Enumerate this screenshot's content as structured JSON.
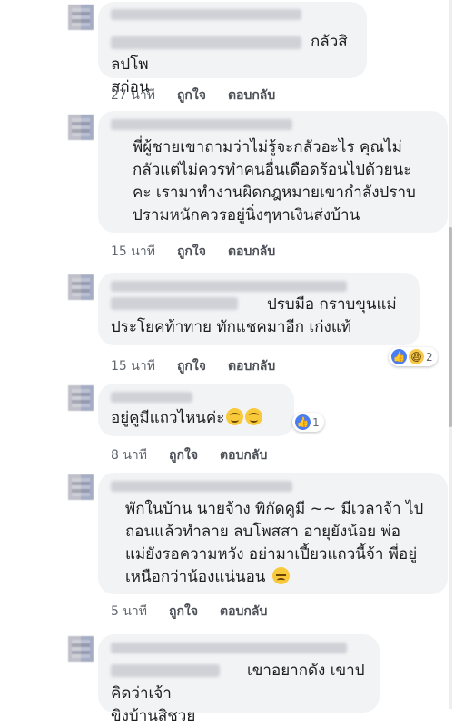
{
  "comments": [
    {
      "text": "กลัวสิลปโพ\nสก่อน",
      "time": "27 นาที",
      "like": "ถูกใจ",
      "reply": "ตอบกลับ"
    },
    {
      "text": "พี่ผู้ชายเขาถามว่าไม่รู้จะกลัวอะไร คุณไม่\nกลัวแต่ไม่ควรทำคนอื่นเดือดร้อนไปด้วยนะ\nคะ เรามาทำงานผิดกฎหมายเขากำลังปราบ\nปรามหนักควรอยู่นิ่งๆหาเงินส่งบ้าน",
      "time": "15 นาที",
      "like": "ถูกใจ",
      "reply": "ตอบกลับ"
    },
    {
      "text": "ปรบมือ กราบขุนแม่\nประโยคท้าทาย ทักแชคมาอีก เก่งแท้",
      "time": "15 นาที",
      "like": "ถูกใจ",
      "reply": "ตอบกลับ",
      "reaction_count": "2"
    },
    {
      "text": "อยู่คูมีแถวไหนค่ะ",
      "time": "8 นาที",
      "like": "ถูกใจ",
      "reply": "ตอบกลับ",
      "reaction_count": "1"
    },
    {
      "text": "พักในบ้าน นายจ้าง พิกัดคูมี ~~ มีเวลาจ้า ไป\nถอนแล้วทำลาย ลบโพสสา อายุยังน้อย พ่อ\nแม่ยังรอความหวัง อย่ามาเปี้ยวแถวนี้จ้า พี่อยู่\nเหนือกว่าน้องแน่นอน",
      "time": "5 นาที",
      "like": "ถูกใจ",
      "reply": "ตอบกลับ"
    },
    {
      "text": "เขาอยากดัง เขาปคิดว่าเจ้า\nขิงบ้านสิชวย"
    }
  ],
  "icons": {
    "like": "thumbs-up-icon",
    "haha": "laughing-face-icon",
    "smile": "smiling-face-icon",
    "worried": "worried-face-icon"
  }
}
